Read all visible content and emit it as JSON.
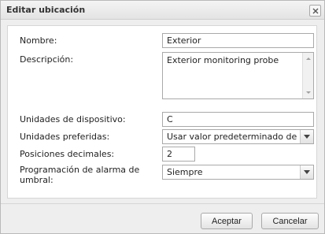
{
  "dialog": {
    "title": "Editar ubicación",
    "close_icon": "close-icon"
  },
  "form": {
    "name_label": "Nombre:",
    "name_value": "Exterior",
    "description_label": "Descripción:",
    "description_value": "Exterior monitoring probe",
    "device_units_label": "Unidades de dispositivo:",
    "device_units_value": "C",
    "preferred_units_label": "Unidades preferidas:",
    "preferred_units_value": "Usar valor predeterminado del si",
    "decimal_positions_label": "Posiciones decimales:",
    "decimal_positions_value": "2",
    "threshold_schedule_label_line1": "Programación de alarma de",
    "threshold_schedule_label_line2": "umbral:",
    "threshold_schedule_value": "Siempre"
  },
  "buttons": {
    "accept_label": "Aceptar",
    "cancel_label": "Cancelar"
  }
}
